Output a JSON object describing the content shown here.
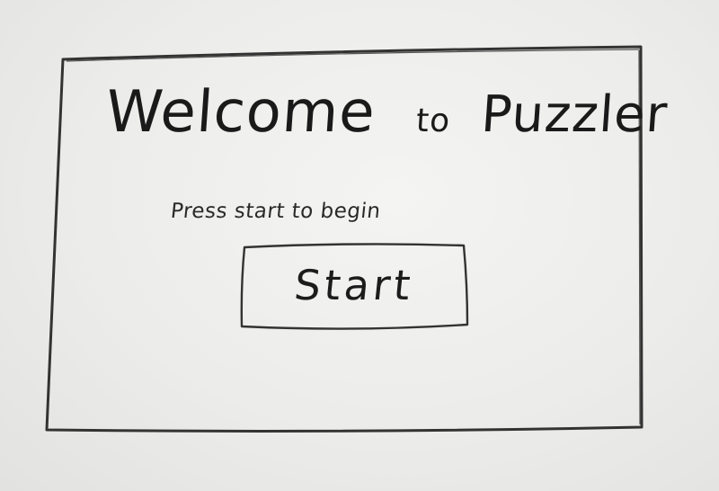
{
  "welcome_screen": {
    "title_words": [
      "Welcome",
      "to",
      "Puzzler"
    ],
    "subtitle": "Press start to begin",
    "start_button_label": "Start"
  }
}
